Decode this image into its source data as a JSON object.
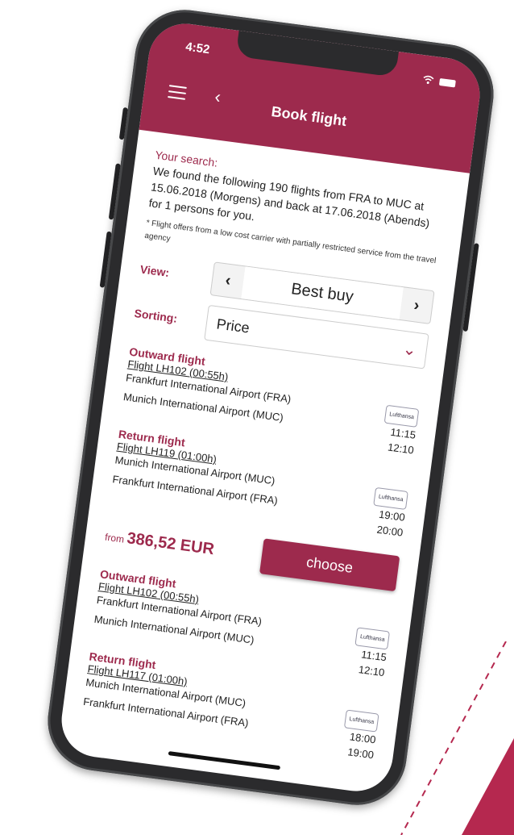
{
  "status": {
    "time": "4:52"
  },
  "header": {
    "title": "Book flight"
  },
  "search": {
    "label": "Your search:",
    "text": "We found the following 190 flights from FRA to MUC at 15.06.2018 (Morgens) and back at 17.06.2018 (Abends) for 1 persons for you.",
    "note": "* Flight offers from a low cost carrier with partially restricted service from the travel agency"
  },
  "view": {
    "label": "View:",
    "value": "Best buy"
  },
  "sorting": {
    "label": "Sorting:",
    "value": "Price"
  },
  "offers": [
    {
      "outward": {
        "label": "Outward flight",
        "flight": "Flight LH102 (00:55h)",
        "from": "Frankfurt International Airport (FRA)",
        "to": "Munich International Airport (MUC)",
        "dep": "11:15",
        "arr": "12:10"
      },
      "return": {
        "label": "Return flight",
        "flight": "Flight LH119 (01:00h)",
        "from": "Munich International Airport (MUC)",
        "to": "Frankfurt International Airport (FRA)",
        "dep": "19:00",
        "arr": "20:00"
      },
      "price_prefix": "from",
      "price": "386,52 EUR",
      "choose": "choose"
    },
    {
      "outward": {
        "label": "Outward flight",
        "flight": "Flight LH102 (00:55h)",
        "from": "Frankfurt International Airport (FRA)",
        "to": "Munich International Airport (MUC)",
        "dep": "11:15",
        "arr": "12:10"
      },
      "return": {
        "label": "Return flight",
        "flight": "Flight LH117 (01:00h)",
        "from": "Munich International Airport (MUC)",
        "to": "Frankfurt International Airport (FRA)",
        "dep": "18:00",
        "arr": "19:00"
      }
    }
  ],
  "airline_logo": "Lufthansa",
  "colors": {
    "accent": "#9d2a4d",
    "frame": "#2b2b2d",
    "corner": "#b5284f"
  }
}
